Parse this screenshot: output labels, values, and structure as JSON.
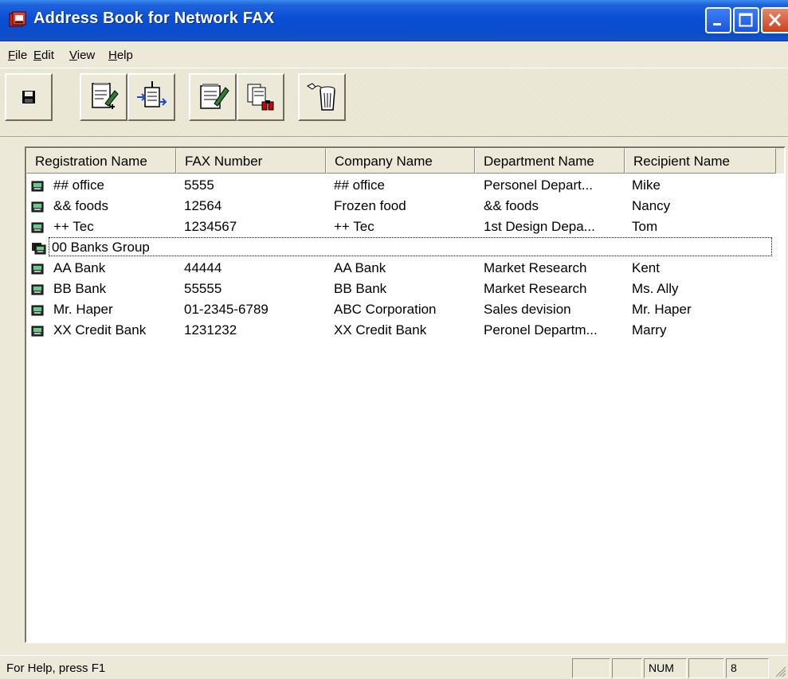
{
  "window": {
    "title": "Address Book for Network FAX",
    "buttons": [
      "minimize",
      "maximize",
      "close"
    ]
  },
  "menu": {
    "items": [
      {
        "label": "File"
      },
      {
        "label": "Edit"
      },
      {
        "label": "View"
      },
      {
        "label": "Help"
      }
    ]
  },
  "toolbar": {
    "buttons": [
      {
        "icon": "save-icon"
      },
      {
        "icon": "new-entry-icon"
      },
      {
        "icon": "import-icon"
      },
      {
        "icon": "new-group-icon"
      },
      {
        "icon": "search-icon"
      },
      {
        "icon": "delete-icon"
      }
    ]
  },
  "list": {
    "columns": [
      {
        "label": "Registration Name"
      },
      {
        "label": "FAX Number"
      },
      {
        "label": "Company Name"
      },
      {
        "label": "Department Name"
      },
      {
        "label": "Recipient Name"
      }
    ],
    "rows": [
      {
        "type": "person",
        "cells": [
          "## office",
          "5555",
          "## office",
          "Personel Depart...",
          "Mike"
        ]
      },
      {
        "type": "person",
        "cells": [
          "&& foods",
          "12564",
          "Frozen food",
          "&& foods",
          "Nancy"
        ]
      },
      {
        "type": "person",
        "cells": [
          "++ Tec",
          "1234567",
          "++ Tec",
          "1st Design Depa...",
          "Tom"
        ]
      },
      {
        "type": "group",
        "focused": true,
        "cells": [
          "00 Banks Group",
          "",
          "",
          "",
          ""
        ]
      },
      {
        "type": "person",
        "cells": [
          "AA Bank",
          "44444",
          "AA Bank",
          "Market Research",
          "Kent"
        ]
      },
      {
        "type": "person",
        "cells": [
          "BB Bank",
          "55555",
          "BB Bank",
          "Market Research",
          "Ms. Ally"
        ]
      },
      {
        "type": "person",
        "cells": [
          "Mr. Haper",
          "01-2345-6789",
          "ABC Corporation",
          "Sales devision",
          "Mr. Haper"
        ]
      },
      {
        "type": "person",
        "cells": [
          "XX Credit Bank",
          "1231232",
          "XX Credit Bank",
          "Peronel Departm...",
          "Marry"
        ]
      }
    ]
  },
  "status": {
    "help_text": "For Help, press F1",
    "panes": [
      "",
      "",
      "NUM",
      "",
      "8"
    ]
  },
  "colors": {
    "titlebar": "#0a4fd4",
    "face": "#ece9d8",
    "close": "#c9431c"
  }
}
